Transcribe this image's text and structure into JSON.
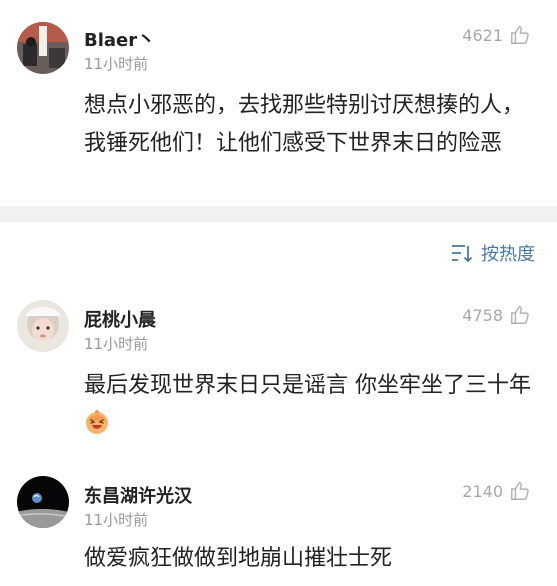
{
  "comments": [
    {
      "user": "Blaer丶",
      "time": "11小时前",
      "likes": "4621",
      "text": "想点小邪恶的，去找那些特别讨厌想揍的人，我锤死他们！让他们感受下世界末日的险恶",
      "avatar": "avatar-room-photo"
    },
    {
      "user": "屁桃小晨",
      "time": "11小时前",
      "likes": "4758",
      "text": "最后发现世界末日只是谣言 你坐牢坐了三十年",
      "emoji": "laughing-face-emoji",
      "avatar": "avatar-child-photo"
    },
    {
      "user": "东昌湖许光汉",
      "time": "11小时前",
      "likes": "2140",
      "text": "做爱疯狂做做到地崩山摧壮士死",
      "avatar": "avatar-earth-from-moon"
    }
  ],
  "sort": {
    "label": "按热度",
    "icon": "sort-icon"
  },
  "colors": {
    "link": "#4a7aa8",
    "meta": "#9a9a9a",
    "divider": "#f1f1f1"
  }
}
